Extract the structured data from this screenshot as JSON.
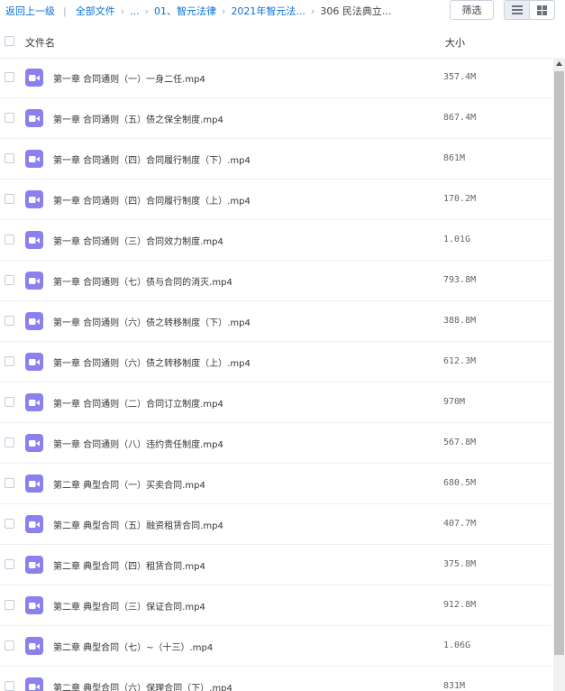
{
  "breadcrumb": {
    "back_label": "返回上一级",
    "all_files_label": "全部文件",
    "ellipsis_label": "...",
    "folder1_label": "01、智元法律",
    "folder2_label": "2021年智元法...",
    "current_label": "306 民法典立..."
  },
  "toolbar": {
    "filter_label": "筛选"
  },
  "header": {
    "name_col": "文件名",
    "size_col": "大小"
  },
  "icons": {
    "file_type": "video-file-icon",
    "file_icon_color": "#8a80ee"
  },
  "files": [
    {
      "name": "第一章 合同通则（一）一身二任.mp4",
      "size": "357.4M"
    },
    {
      "name": "第一章 合同通则（五）债之保全制度.mp4",
      "size": "867.4M"
    },
    {
      "name": "第一章 合同通则（四）合同履行制度（下）.mp4",
      "size": "861M"
    },
    {
      "name": "第一章 合同通则（四）合同履行制度（上）.mp4",
      "size": "170.2M"
    },
    {
      "name": "第一章 合同通则（三）合同效力制度.mp4",
      "size": "1.01G"
    },
    {
      "name": "第一章 合同通则（七）债与合同的消灭.mp4",
      "size": "793.8M"
    },
    {
      "name": "第一章 合同通则（六）债之转移制度（下）.mp4",
      "size": "388.8M"
    },
    {
      "name": "第一章 合同通则（六）债之转移制度（上）.mp4",
      "size": "612.3M"
    },
    {
      "name": "第一章 合同通则（二）合同订立制度.mp4",
      "size": "970M"
    },
    {
      "name": "第一章 合同通则（八）违约责任制度.mp4",
      "size": "567.8M"
    },
    {
      "name": "第二章 典型合同（一）买卖合同.mp4",
      "size": "680.5M"
    },
    {
      "name": "第二章 典型合同（五）融资租赁合同.mp4",
      "size": "407.7M"
    },
    {
      "name": "第二章 典型合同（四）租赁合同.mp4",
      "size": "375.8M"
    },
    {
      "name": "第二章 典型合同（三）保证合同.mp4",
      "size": "912.8M"
    },
    {
      "name": "第二章 典型合同（七）~（十三）.mp4",
      "size": "1.06G"
    },
    {
      "name": "第二章 典型合同（六）保理合同（下）.mp4",
      "size": "831M"
    }
  ]
}
